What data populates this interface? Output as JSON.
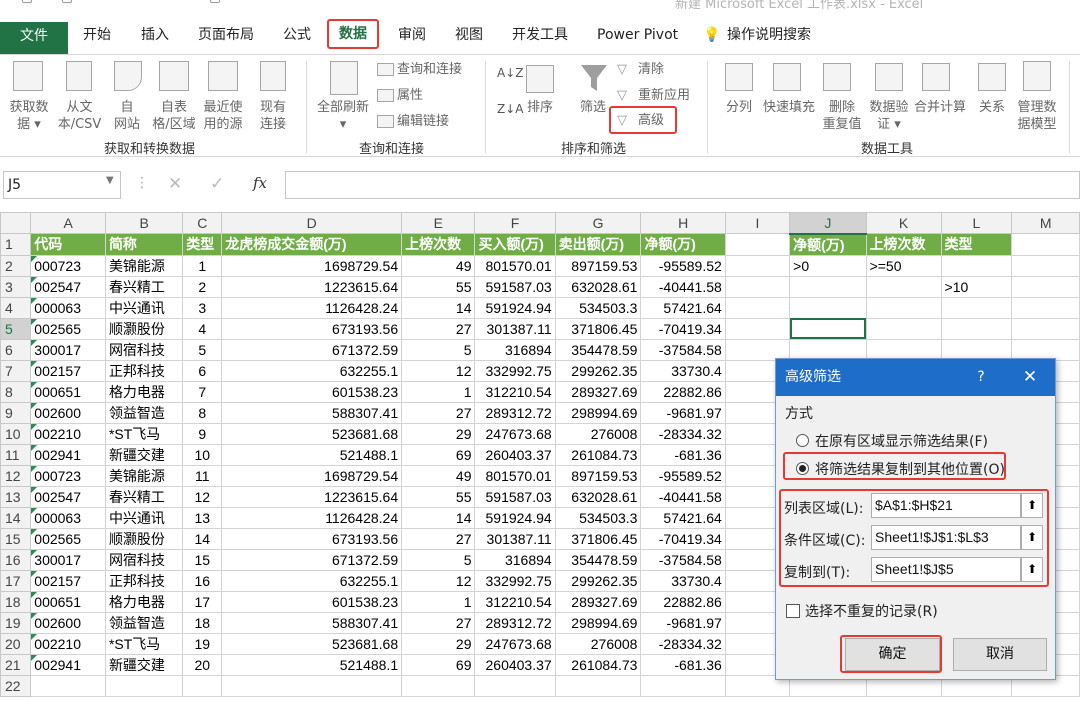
{
  "window": {
    "title": "新建 Microsoft Excel 工作表.xlsx - Excel"
  },
  "ribbon_tabs": [
    "文件",
    "开始",
    "插入",
    "页面布局",
    "公式",
    "数据",
    "审阅",
    "视图",
    "开发工具",
    "Power Pivot"
  ],
  "active_tab": "数据",
  "tell_me": "操作说明搜索",
  "ribbon": {
    "get_data": {
      "line1": "获取数",
      "line2": "据 ▾"
    },
    "from_text": {
      "line1": "从文",
      "line2": "本/CSV"
    },
    "from_web": {
      "line1": "自",
      "line2": "网站"
    },
    "from_table": {
      "line1": "自表",
      "line2": "格/区域"
    },
    "recent_sources": {
      "line1": "最近使",
      "line2": "用的源"
    },
    "existing_conn": {
      "line1": "现有",
      "line2": "连接"
    },
    "refresh_all": {
      "line1": "全部刷新",
      "line2": "▾"
    },
    "queries_conn": "查询和连接",
    "properties": "属性",
    "edit_links": "编辑链接",
    "sort": "排序",
    "filter": "筛选",
    "clear": "清除",
    "reapply": "重新应用",
    "advanced": "高级",
    "text_to_cols": "分列",
    "flash_fill": "快速填充",
    "remove_dup": {
      "line1": "删除",
      "line2": "重复值"
    },
    "data_valid": {
      "line1": "数据验",
      "line2": "证 ▾"
    },
    "consolidate": "合并计算",
    "relations": "关系",
    "data_model": {
      "line1": "管理数",
      "line2": "据模型"
    },
    "groups": {
      "get_transform": "获取和转换数据",
      "queries": "查询和连接",
      "sort_filter": "排序和筛选",
      "data_tools": "数据工具"
    }
  },
  "formula_bar": {
    "name_box": "J5",
    "fx": "fx",
    "formula": ""
  },
  "columns": [
    "A",
    "B",
    "C",
    "D",
    "E",
    "F",
    "G",
    "H",
    "I",
    "J",
    "K",
    "L",
    "M"
  ],
  "headers": [
    "代码",
    "简称",
    "类型",
    "龙虎榜成交金额(万)",
    "上榜次数",
    "买入额(万)",
    "卖出额(万)",
    "净额(万)"
  ],
  "rows": [
    [
      "000723",
      "美锦能源",
      "1",
      "1698729.54",
      "49",
      "801570.01",
      "897159.53",
      "-95589.52"
    ],
    [
      "002547",
      "春兴精工",
      "2",
      "1223615.64",
      "55",
      "591587.03",
      "632028.61",
      "-40441.58"
    ],
    [
      "000063",
      "中兴通讯",
      "3",
      "1126428.24",
      "14",
      "591924.94",
      "534503.3",
      "57421.64"
    ],
    [
      "002565",
      "顺灏股份",
      "4",
      "673193.56",
      "27",
      "301387.11",
      "371806.45",
      "-70419.34"
    ],
    [
      "300017",
      "网宿科技",
      "5",
      "671372.59",
      "5",
      "316894",
      "354478.59",
      "-37584.58"
    ],
    [
      "002157",
      "正邦科技",
      "6",
      "632255.1",
      "12",
      "332992.75",
      "299262.35",
      "33730.4"
    ],
    [
      "000651",
      "格力电器",
      "7",
      "601538.23",
      "1",
      "312210.54",
      "289327.69",
      "22882.86"
    ],
    [
      "002600",
      "领益智造",
      "8",
      "588307.41",
      "27",
      "289312.72",
      "298994.69",
      "-9681.97"
    ],
    [
      "002210",
      "*ST飞马",
      "9",
      "523681.68",
      "29",
      "247673.68",
      "276008",
      "-28334.32"
    ],
    [
      "002941",
      "新疆交建",
      "10",
      "521488.1",
      "69",
      "260403.37",
      "261084.73",
      "-681.36"
    ],
    [
      "000723",
      "美锦能源",
      "11",
      "1698729.54",
      "49",
      "801570.01",
      "897159.53",
      "-95589.52"
    ],
    [
      "002547",
      "春兴精工",
      "12",
      "1223615.64",
      "55",
      "591587.03",
      "632028.61",
      "-40441.58"
    ],
    [
      "000063",
      "中兴通讯",
      "13",
      "1126428.24",
      "14",
      "591924.94",
      "534503.3",
      "57421.64"
    ],
    [
      "002565",
      "顺灏股份",
      "14",
      "673193.56",
      "27",
      "301387.11",
      "371806.45",
      "-70419.34"
    ],
    [
      "300017",
      "网宿科技",
      "15",
      "671372.59",
      "5",
      "316894",
      "354478.59",
      "-37584.58"
    ],
    [
      "002157",
      "正邦科技",
      "16",
      "632255.1",
      "12",
      "332992.75",
      "299262.35",
      "33730.4"
    ],
    [
      "000651",
      "格力电器",
      "17",
      "601538.23",
      "1",
      "312210.54",
      "289327.69",
      "22882.86"
    ],
    [
      "002600",
      "领益智造",
      "18",
      "588307.41",
      "27",
      "289312.72",
      "298994.69",
      "-9681.97"
    ],
    [
      "002210",
      "*ST飞马",
      "19",
      "523681.68",
      "29",
      "247673.68",
      "276008",
      "-28334.32"
    ],
    [
      "002941",
      "新疆交建",
      "20",
      "521488.1",
      "69",
      "260403.37",
      "261084.73",
      "-681.36"
    ]
  ],
  "criteria": {
    "headers": [
      "净额(万)",
      "上榜次数",
      "类型"
    ],
    "row2": [
      ">0",
      ">=50",
      ""
    ],
    "row3": [
      "",
      "",
      ">10"
    ]
  },
  "selected_cell": "J5",
  "dialog": {
    "title": "高级筛选",
    "help": "?",
    "close": "✕",
    "mode_label": "方式",
    "option1": "在原有区域显示筛选结果(F)",
    "option2": "将筛选结果复制到其他位置(O)",
    "list_range_label": "列表区域(L):",
    "list_range_value": "$A$1:$H$21",
    "criteria_label": "条件区域(C):",
    "criteria_value": "Sheet1!$J$1:$L$3",
    "copy_to_label": "复制到(T):",
    "copy_to_value": "Sheet1!$J$5",
    "unique_label": "选择不重复的记录(R)",
    "ok": "确定",
    "cancel": "取消"
  },
  "colors": {
    "excel_green": "#217346",
    "header_green": "#70ad47",
    "dialog_blue": "#1e6dc9",
    "highlight_red": "#e53935"
  }
}
